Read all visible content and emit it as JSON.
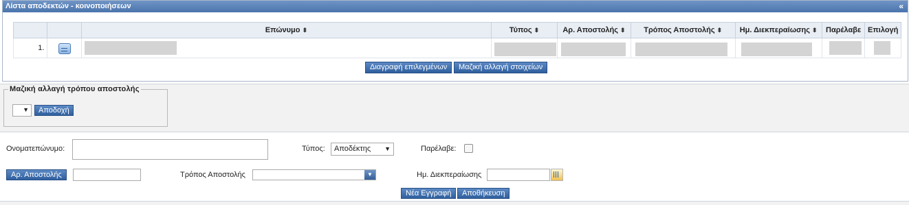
{
  "panel": {
    "title": "Λίστα αποδεκτών - κοινοποιήσεων",
    "collapse_glyph": "«"
  },
  "grid": {
    "columns": [
      "",
      "",
      "Επώνυμο",
      "Τύπος",
      "Αρ. Αποστολής",
      "Τρόπος Αποστολής",
      "Ημ. Διεκπεραίωσης",
      "Παρέλαβε",
      "Επιλογή"
    ],
    "sort_glyph": "⬍",
    "rows": [
      {
        "index": "1."
      }
    ]
  },
  "grid_actions": {
    "delete_selected": "Διαγραφή επιλεγμένων",
    "bulk_change": "Μαζική αλλαγή στοιχείων"
  },
  "mass_change": {
    "legend": "Μαζική αλλαγή τρόπου αποστολής",
    "select_value": "",
    "accept": "Αποδοχή"
  },
  "form": {
    "name_label": "Ονοματεπώνυμο:",
    "name_value": "",
    "type_label": "Τύπος:",
    "type_value": "Αποδέκτης",
    "received_label": "Παρέλαβε:",
    "send_no_button": "Αρ. Αποστολής",
    "send_no_value": "",
    "send_method_label": "Τρόπος Αποστολής",
    "send_method_value": "",
    "date_label": "Ημ. Διεκπεραίωσης",
    "date_value": "",
    "new_record": "Νέα Εγγραφή",
    "save": "Αποθήκευση"
  }
}
